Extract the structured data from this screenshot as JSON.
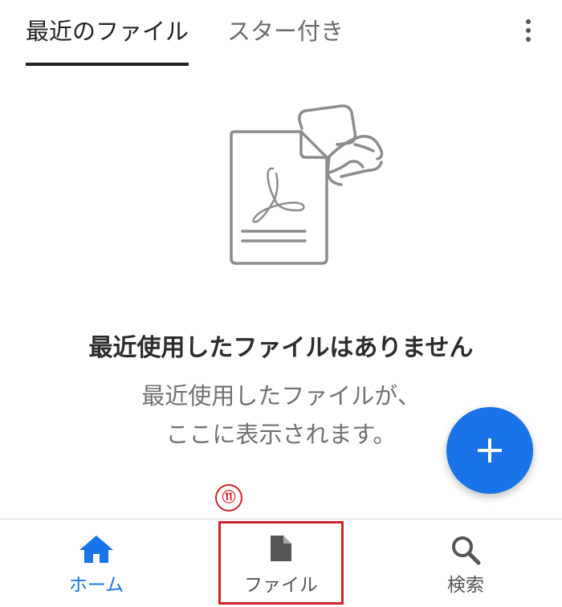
{
  "tabs": {
    "recent": "最近のファイル",
    "starred": "スター付き"
  },
  "empty_state": {
    "title": "最近使用したファイルはありません",
    "subtitle_line1": "最近使用したファイルが、",
    "subtitle_line2": "ここに表示されます。"
  },
  "fab": {
    "icon": "plus-icon"
  },
  "annotation": {
    "label": "⑪"
  },
  "bottom_nav": {
    "home": "ホーム",
    "files": "ファイル",
    "search": "検索"
  },
  "colors": {
    "accent": "#1a73e8",
    "annotation_red": "#d2232a"
  }
}
